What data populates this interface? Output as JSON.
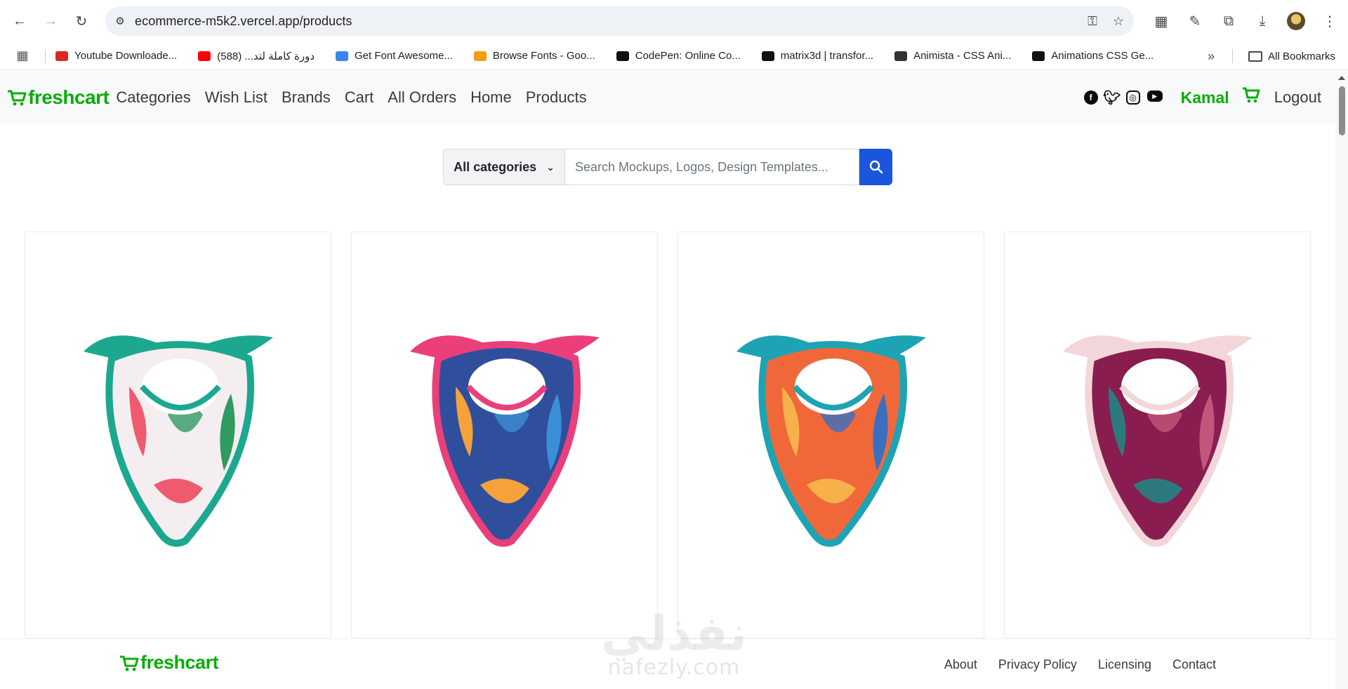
{
  "browser": {
    "url": "ecommerce-m5k2.vercel.app/products",
    "bookmarks": [
      {
        "label": "Youtube Downloade...",
        "color": "#e02424"
      },
      {
        "label": "دورة كاملة لتد... (588)",
        "color": "#ff0000"
      },
      {
        "label": "Get Font Awesome...",
        "color": "#3b82f6"
      },
      {
        "label": "Browse Fonts - Goo...",
        "color": "#f59e0b"
      },
      {
        "label": "CodePen: Online Co...",
        "color": "#111111"
      },
      {
        "label": "matrix3d | transfor...",
        "color": "#111111"
      },
      {
        "label": "Animista - CSS Ani...",
        "color": "#333333"
      },
      {
        "label": "Animations CSS Ge...",
        "color": "#111111"
      }
    ],
    "more_label": "»",
    "all_bookmarks": "All Bookmarks"
  },
  "navbar": {
    "brand_main": "fresh",
    "brand_accent": "cart",
    "links": [
      "Categories",
      "Wish List",
      "Brands",
      "Cart",
      "All Orders",
      "Home",
      "Products"
    ],
    "social": [
      "facebook-icon",
      "twitter-icon",
      "instagram-icon",
      "youtube-icon"
    ],
    "user": "Kamal",
    "logout": "Logout"
  },
  "search": {
    "category": "All categories",
    "placeholder": "Search Mockups, Logos, Design Templates..."
  },
  "products": [
    {
      "name": "scarf-white-green-floral",
      "colors": [
        "#f4eef0",
        "#1ba88f",
        "#ef5b6e",
        "#2f9a62"
      ]
    },
    {
      "name": "scarf-blue-pink-pattern",
      "colors": [
        "#2f4f9c",
        "#ea3f7a",
        "#f5a23a",
        "#3c8fd6"
      ]
    },
    {
      "name": "scarf-orange-teal-geometric",
      "colors": [
        "#f0683a",
        "#1ea3b4",
        "#f6b14a",
        "#3a6fc0"
      ]
    },
    {
      "name": "scarf-maroon-leaves",
      "colors": [
        "#8a1d4f",
        "#f2d6da",
        "#2d7a7e",
        "#c0577a"
      ]
    }
  ],
  "footer": {
    "brand_main": "fresh",
    "brand_accent": "cart",
    "links": [
      "About",
      "Privacy Policy",
      "Licensing",
      "Contact"
    ]
  },
  "watermark": {
    "arabic": "نفذلي",
    "latin": "nafezly.com"
  },
  "colors": {
    "brand": "#0aad0a",
    "search_button": "#1a56db"
  }
}
